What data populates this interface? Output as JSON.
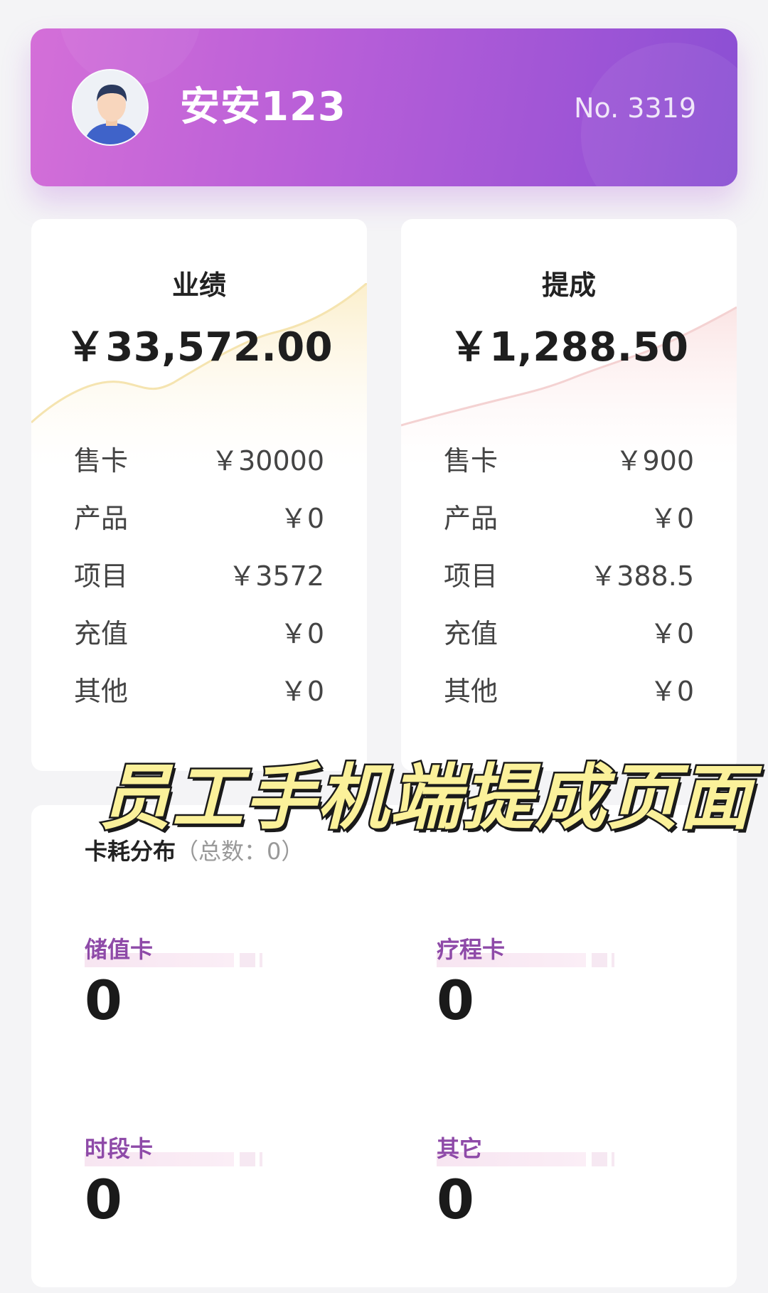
{
  "header": {
    "username": "安安123",
    "staff_no": "No. 3319",
    "gradient": [
      "#d46fd8",
      "#8a4fd3"
    ]
  },
  "performance": {
    "title": "业绩",
    "amount": "￥33,572.00",
    "rows": [
      {
        "label": "售卡",
        "value": "￥30000"
      },
      {
        "label": "产品",
        "value": "￥0"
      },
      {
        "label": "项目",
        "value": "￥3572"
      },
      {
        "label": "充值",
        "value": "￥0"
      },
      {
        "label": "其他",
        "value": "￥0"
      }
    ]
  },
  "commission": {
    "title": "提成",
    "amount": "￥1,288.50",
    "rows": [
      {
        "label": "售卡",
        "value": "￥900"
      },
      {
        "label": "产品",
        "value": "￥0"
      },
      {
        "label": "项目",
        "value": "￥388.5"
      },
      {
        "label": "充值",
        "value": "￥0"
      },
      {
        "label": "其他",
        "value": "￥0"
      }
    ]
  },
  "caption": "员工手机端提成页面",
  "card_distribution": {
    "title": "卡耗分布",
    "total_text": "（总数：0）",
    "items": [
      {
        "name": "储值卡",
        "count": "0"
      },
      {
        "name": "疗程卡",
        "count": "0"
      },
      {
        "name": "时段卡",
        "count": "0"
      },
      {
        "name": "其它",
        "count": "0"
      }
    ]
  }
}
